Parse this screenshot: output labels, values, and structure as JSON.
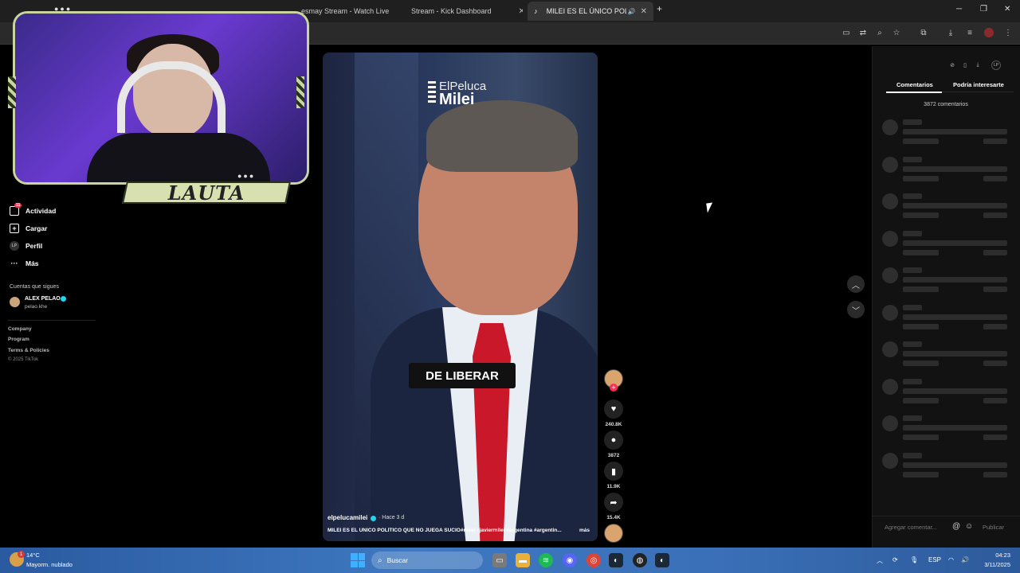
{
  "browser": {
    "tabs": [
      {
        "label": "esmay Stream - Watch Live"
      },
      {
        "label": "Stream - Kick Dashboard"
      },
      {
        "label": "MILEI ES EL ÚNICO POLÍTIC"
      }
    ],
    "new_tab_icon": "plus-icon",
    "window_controls": [
      "minimize-icon",
      "restore-icon",
      "close-icon"
    ]
  },
  "overlay": {
    "streamer_name": "LAUTA"
  },
  "sidebar": {
    "items": [
      {
        "label": "Actividad",
        "icon": "activity-icon",
        "badge": "11"
      },
      {
        "label": "Cargar",
        "icon": "upload-icon"
      },
      {
        "label": "Perfil",
        "icon": "profile-icon"
      },
      {
        "label": "Más",
        "icon": "more-icon"
      }
    ],
    "following_heading": "Cuentas que sigues",
    "following": [
      {
        "name": "ALEX PELAO",
        "username": "pelao.khe"
      }
    ],
    "footer": [
      "Company",
      "Program",
      "Terms & Policies",
      "© 2025 TikTok"
    ]
  },
  "video": {
    "logo_top": "ElPeluca",
    "logo_bottom": "Milei",
    "caption": "DE LIBERAR",
    "author": "elpelucamilei",
    "posted": "· Hace 3 d",
    "description": "MILEI ES EL ÚNICO POLÍTICO QUE NO JUEGA SUCIO#milei #javiermilei #argentina #argentin...",
    "more_label": "más"
  },
  "actions": {
    "likes": "240.8K",
    "comments": "3872",
    "saves": "11.9K",
    "shares": "15.4K"
  },
  "panel": {
    "tab_comments": "Comentarios",
    "tab_related": "Podría interesarte",
    "comment_count": "3872 comentarios",
    "input_placeholder": "Agregar comentar...",
    "publish_label": "Publicar"
  },
  "taskbar": {
    "weather_badge": "1",
    "temperature": "14°C",
    "weather": "Mayorm. nublado",
    "search_placeholder": "Buscar",
    "language": "ESP",
    "time": "04:23",
    "date": "3/11/2025"
  },
  "colors": {
    "tiktok_red": "#fe2c55",
    "overlay_frame": "#c9d5a0",
    "taskbar_blue": "#3e78c0"
  }
}
